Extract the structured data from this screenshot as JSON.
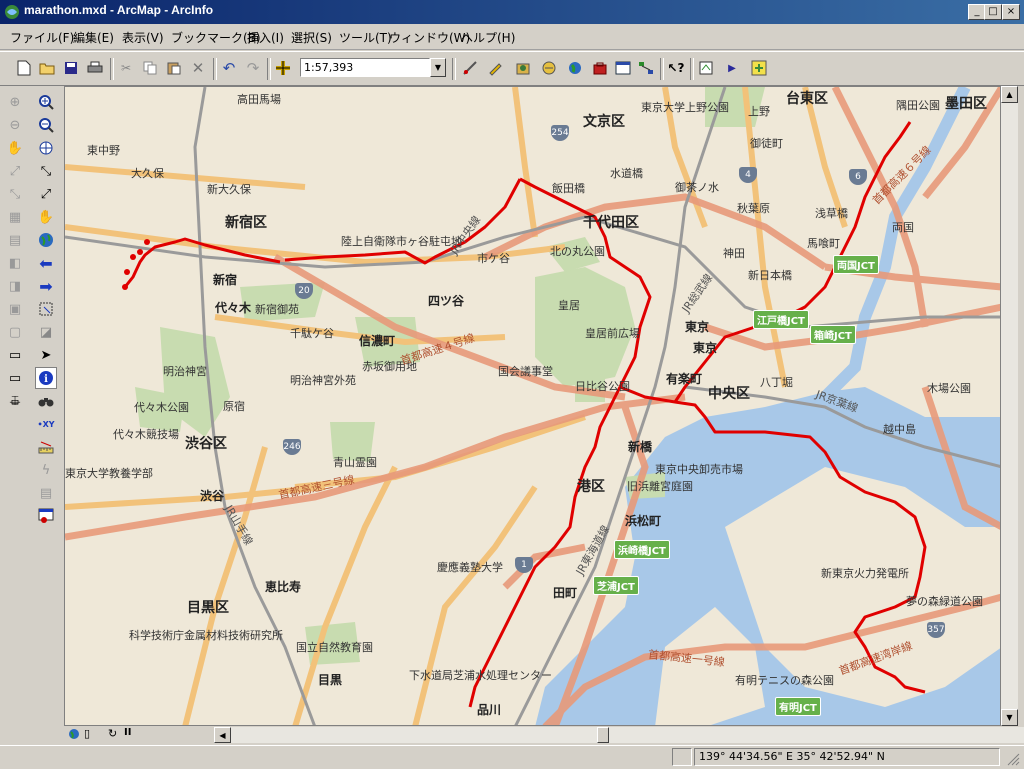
{
  "window": {
    "title": "marathon.mxd - ArcMap - ArcInfo",
    "min_label": "_",
    "max_label": "□",
    "close_label": "×"
  },
  "menu": [
    "ファイル(F)",
    "編集(E)",
    "表示(V)",
    "ブックマーク(B)",
    "挿入(I)",
    "選択(S)",
    "ツール(T)",
    "ウィンドウ(W)",
    "ヘルプ(H)"
  ],
  "toolbar": {
    "scale_value": "1:57,393"
  },
  "map": {
    "labels": {
      "takadanobaba": "高田馬場",
      "bunkyo": "文京区",
      "todai_ueno": "東京大学上野公園",
      "ueno": "上野",
      "taito": "台東区",
      "sumida_park": "隅田公園",
      "sumida": "墨田区",
      "okachimachi": "御徒町",
      "higashinakano": "東中野",
      "okubo": "大久保",
      "shinokubo": "新大久保",
      "suidobashi": "水道橋",
      "ochanomizu": "御茶ノ水",
      "iidabashi": "飯田橋",
      "akihabara": "秋葉原",
      "asakusabashi": "浅草橋",
      "shinjuku_ku": "新宿区",
      "chiyoda": "千代田区",
      "ryogoku": "両国",
      "bakurocho": "馬喰町",
      "jieitai": "陸上自衛隊市ヶ谷駐屯地",
      "kitanomaru": "北の丸公園",
      "kanda": "神田",
      "ichigaya": "市ケ谷",
      "shinnihonbashi": "新日本橋",
      "shinjuku": "新宿",
      "yotsuya": "四ツ谷",
      "kokyo": "皇居",
      "yoyogi": "代々木",
      "shinjuku_gyoen": "新宿御苑",
      "sendagaya": "千駄ケ谷",
      "shinanomachi": "信濃町",
      "kokyo_mae": "皇居前広場",
      "tokyo_st": "東京",
      "meiji_jingu": "明治神宮",
      "akasaka_palace": "赤坂御用地",
      "kokkai": "国会議事堂",
      "yurakucho": "有楽町",
      "hatchobori": "八丁堀",
      "meiji_gaien": "明治神宮外苑",
      "chuo": "中央区",
      "kiba_park": "木場公園",
      "hibiya_park": "日比谷公園",
      "yoyogi_park": "代々木公園",
      "harajuku": "原宿",
      "etchujima": "越中島",
      "yoyogi_stadium": "代々木競技場",
      "shinbashi": "新橋",
      "shibuya_ku": "渋谷区",
      "aoyama_cemetery": "青山霊園",
      "tsukiji": "東京中央卸売市場",
      "todai_komaba": "東京大学教養学部",
      "minato": "港区",
      "hamarikyu": "旧浜離宮庭園",
      "shibuya": "渋谷",
      "hamamatsucho": "浜松町",
      "keio": "慶應義塾大学",
      "shintokyo_power": "新東京火力発電所",
      "ebisu": "恵比寿",
      "tamachi": "田町",
      "yumenomori": "夢の森緑道公園",
      "meguro_ku": "目黒区",
      "kagaku": "科学技術庁金属材料技術研究所",
      "shizenkyoiku": "国立自然教育園",
      "gesuido": "下水道局芝浦水処理センター",
      "ariake_tennis": "有明テニスの森公園",
      "meguro": "目黒",
      "shinagawa": "品川",
      "shutoko_4": "首都高速４号線",
      "shutoko_3": "首都高速三号線",
      "shutoko_wangan": "首都高速湾岸線",
      "shutoko_1": "首都高速一号線",
      "jr_chuo": "JR中央線",
      "jr_sobu": "JR総武線",
      "jr_keiyo": "JR京葉線",
      "jr_yamanote": "JR山手線",
      "jr_tokaido": "JR東海道線",
      "shutoko_6": "首都高速６号線"
    },
    "badges": {
      "ryogoku_jct": "両国JCT",
      "edobashi_jct": "江戸橋JCT",
      "hakozaki_jct": "箱崎JCT",
      "hamazakibashi_jct": "浜崎橋JCT",
      "shibaura_jct": "芝浦JCT",
      "ariake_jct": "有明JCT"
    },
    "shields": {
      "r254": "254",
      "r4": "4",
      "r6": "6",
      "r20": "20",
      "r246": "246",
      "r1": "1",
      "r357": "357"
    },
    "route_color": "#e00000"
  },
  "status": {
    "coordinates": "139° 44'34.56\" E  35° 42'52.94\" N"
  },
  "colors": {
    "title_bar": "#0a246a",
    "chrome": "#d4d0c8",
    "map_bg": "#efe8d8",
    "park": "#c8dcb0",
    "water": "#a8c8e8",
    "expressway": "#e89a7a",
    "main_road": "#f2c27a",
    "rail": "#9a9a9a"
  }
}
